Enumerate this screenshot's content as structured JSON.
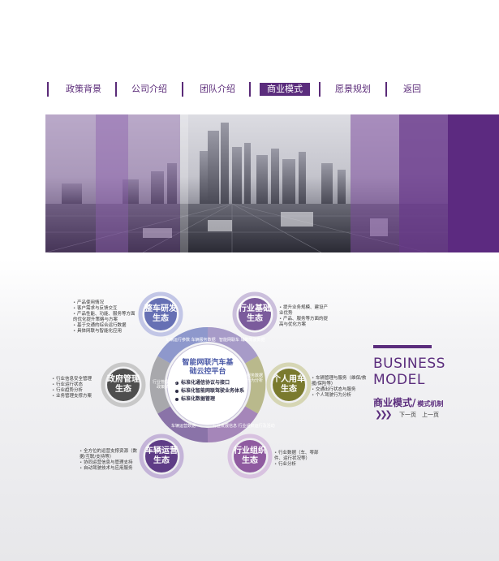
{
  "nav": {
    "items": [
      {
        "label": "政策背景"
      },
      {
        "label": "公司介绍"
      },
      {
        "label": "团队介绍"
      },
      {
        "label": "商业模式",
        "active": true
      },
      {
        "label": "愿景规划"
      },
      {
        "label": "返回"
      }
    ]
  },
  "business": {
    "title_line1": "BUSINESS",
    "title_line2": "MODEL",
    "cn_title": "商业模式/",
    "cn_sub": "模式机制",
    "next_label": "下一页",
    "prev_label": "上一页",
    "arrows": "❯❯❯"
  },
  "diagram": {
    "center": {
      "title": "智能网联汽车基础云控平台",
      "items": [
        "标准化通信协议与接口",
        "标准化智能网联驾驶业务体系",
        "标准化数据管理"
      ]
    },
    "ring_labels": [
      "车辆运行参数 车辆服务数据",
      "智能网联车 辅助驾驶数据",
      "车辆运营数据",
      "行业发展信息 行业组织运行及活动",
      "行业管理数据 政策法规",
      "出行服务数据 驾驶行为分析"
    ],
    "nodes": [
      {
        "id": "oem",
        "label": "整车研发生态",
        "color": "#6670b4",
        "notes": [
          "产品使用情况",
          "客户需求与反馈交互",
          "产品性能、功能、服务等方面的优化提升策略与方案",
          "基于交通的综合运行数据",
          "具体网联与智能化应用"
        ]
      },
      {
        "id": "industry-base",
        "label": "行业基础生态",
        "color": "#7b5b9c",
        "notes": [
          "提升业务规模、建设产业优势",
          "产品、服务等方面的提高与优化方案"
        ]
      },
      {
        "id": "personal",
        "label": "个人用车生态",
        "color": "#7a7a2e",
        "notes": [
          "车辆管理与服务（维保/救援/保险等）",
          "交通出行状态与服务",
          "个人驾驶行为分析"
        ]
      },
      {
        "id": "industry-org",
        "label": "行业组织生态",
        "color": "#8f5aa0",
        "notes": [
          "行业数据（车、零部件、运行状况等）",
          "行业分析"
        ]
      },
      {
        "id": "fleet",
        "label": "车辆运营生态",
        "color": "#5e3c86",
        "notes": [
          "全方位的运营支撑资源（数据/互联/支持等）",
          "协同运营信息与管理支持",
          "自动驾驶技术与应用服务"
        ]
      },
      {
        "id": "government",
        "label": "政府管理生态",
        "color": "#4e4e4e",
        "notes": [
          "行业信息安全管理",
          "行业运行状态",
          "行业趋势分析",
          "业务管理支撑方案"
        ]
      }
    ]
  }
}
